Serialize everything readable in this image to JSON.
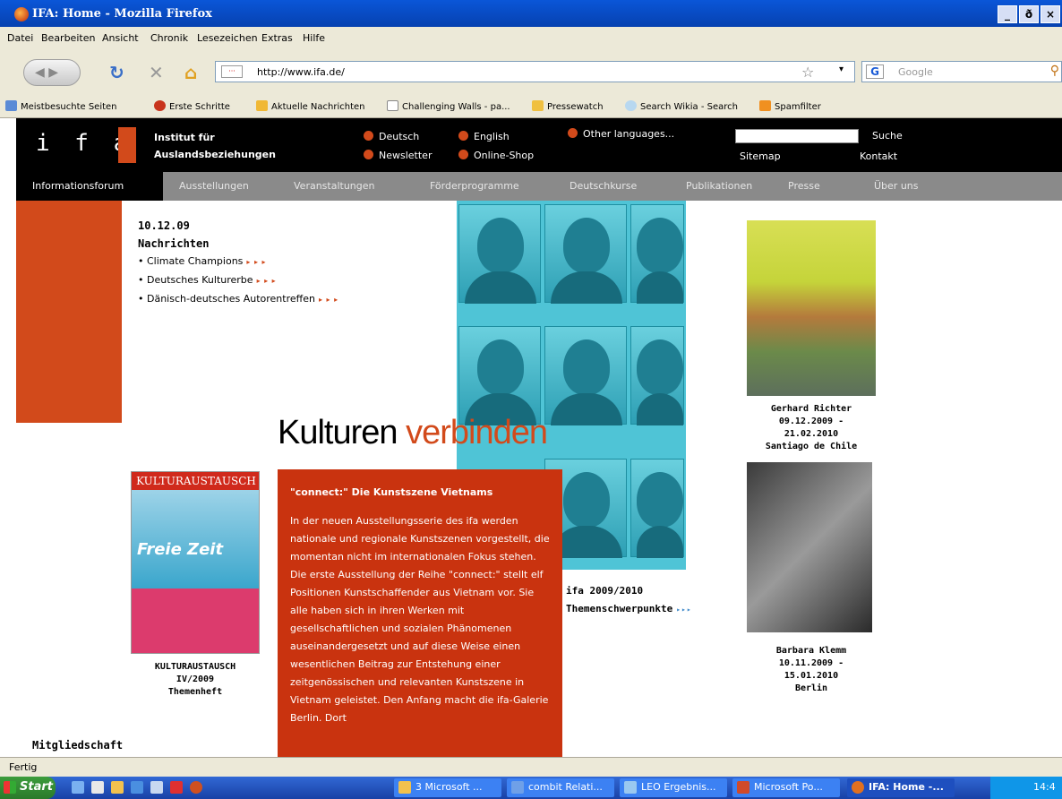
{
  "window": {
    "title": "IFA: Home - Mozilla Firefox",
    "buttons": [
      "_",
      "ð",
      "×"
    ]
  },
  "menu": [
    "Datei",
    "Bearbeiten",
    "Ansicht",
    "Chronik",
    "Lesezeichen",
    "Extras",
    "Hilfe"
  ],
  "nav": {
    "url": "http://www.ifa.de/",
    "search_placeholder": "Google"
  },
  "bookmarks": [
    "Meistbesuchte Seiten",
    "Erste Schritte",
    "Aktuelle Nachrichten",
    "Challenging Walls - pa...",
    "Pressewatch",
    "Search Wikia - Search",
    "Spamfilter"
  ],
  "site": {
    "logo": "i f a",
    "institute_line1": "Institut für",
    "institute_line2": "Auslandsbeziehungen",
    "lang_deutsch": "Deutsch",
    "lang_english": "English",
    "lang_other": "Other languages...",
    "newsletter": "Newsletter",
    "shop": "Online-Shop",
    "search_label": "Suche",
    "sitemap": "Sitemap",
    "kontakt": "Kontakt"
  },
  "mainnav": [
    "Informationsforum",
    "Ausstellungen",
    "Veranstaltungen",
    "Förderprogramme",
    "Deutschkurse",
    "Publikationen",
    "Presse",
    "Über uns"
  ],
  "news": {
    "date": "10.12.09",
    "heading": "Nachrichten",
    "items": [
      "• Climate Champions",
      "• Deutsches Kulturerbe",
      "• Dänisch-deutsches Autorentreffen"
    ],
    "arrows": "▸ ▸ ▸"
  },
  "headline": {
    "black": "Kulturen ",
    "red": "verbinden"
  },
  "feature": {
    "title": "\"connect:\" Die Kunstszene Vietnams",
    "body": "In der neuen Ausstellungsserie des ifa werden nationale und regionale Kunstszenen vorgestellt, die momentan nicht im internationalen Fokus stehen. Die erste Ausstellung der Reihe \"connect:\" stellt elf Positionen Kunstschaffender aus Vietnam vor. Sie alle haben sich in ihren Werken mit gesellschaftlichen und sozialen Phänomenen auseinandergesetzt und auf diese Weise einen wesentlichen Beitrag zur Entstehung einer zeitgenössischen und relevanten Kunstszene in Vietnam geleistet. Den Anfang macht die ifa-Galerie Berlin. Dort"
  },
  "magazine": {
    "masthead": "KULTURAUSTAUSCH",
    "cover_title": "Freie Zeit",
    "caption1": "KULTURAUSTAUSCH",
    "caption2": "IV/2009",
    "caption3": "Themenheft"
  },
  "themen": {
    "line1": "ifa 2009/2010",
    "line2": "Themenschwerpunkte",
    "arrows": "▸▸▸"
  },
  "richter": {
    "name": "Gerhard Richter",
    "from": "09.12.2009 -",
    "to": "21.02.2010",
    "place": "Santiago de Chile"
  },
  "klemm": {
    "name": "Barbara Klemm",
    "from": "10.11.2009 -",
    "to": "15.01.2010",
    "place": "Berlin"
  },
  "mitglied": "Mitgliedschaft",
  "status": "Fertig",
  "taskbar": {
    "start": "Start",
    "tasks": [
      "3 Microsoft ...",
      "combit Relati...",
      "LEO Ergebnis...",
      "Microsoft Po...",
      "IFA: Home -..."
    ],
    "clock": "14:4"
  },
  "colors": {
    "ifa_red": "#d24a1b",
    "feature_red": "#c9330f",
    "nav_gray": "#8a8a8a"
  }
}
